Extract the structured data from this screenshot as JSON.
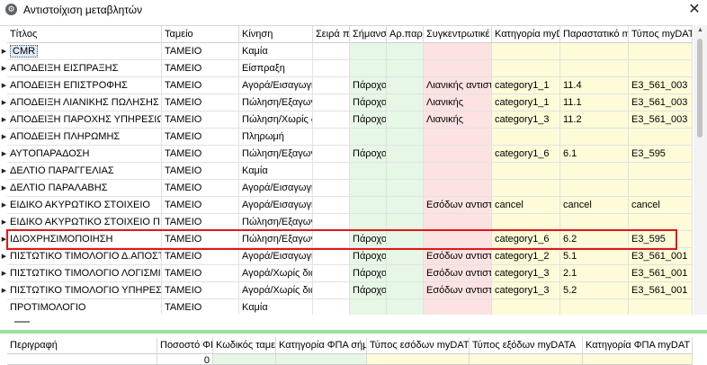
{
  "window": {
    "title": "Αντιστοίχιση μεταβλητών",
    "icon": "gear-icon",
    "close_label": "✕"
  },
  "columns": [
    "Τίτλος",
    "Ταμείο",
    "Κίνηση",
    "Σειρά π",
    "Σήμανσ",
    "Αρ.παρ",
    "Συγκεντρωτικέ",
    "Κατηγορία myDA",
    "Παραστατικό m",
    "Τύπος myDAT"
  ],
  "rows": [
    [
      "CMR",
      "ΤΑΜΕΙΟ",
      "Καμία",
      "",
      "",
      "",
      "",
      "",
      "",
      ""
    ],
    [
      "ΑΠΟΔΕΙΞΗ ΕΙΣΠΡΑΞΗΣ",
      "ΤΑΜΕΙΟ",
      "Είσπραξη",
      "",
      "",
      "",
      "",
      "",
      "",
      ""
    ],
    [
      "ΑΠΟΔΕΙΞΗ ΕΠΙΣΤΡΟΦΗΣ",
      "ΤΑΜΕΙΟ",
      "Αγορά/Εισαγωγή",
      "",
      "Πάροχο",
      "",
      "Λιανικής αντιστ",
      "category1_1",
      "11.4",
      "E3_561_003"
    ],
    [
      "ΑΠΟΔΕΙΞΗ ΛΙΑΝΙΚΗΣ ΠΩΛΗΣΗΣ",
      "ΤΑΜΕΙΟ",
      "Πώληση/Εξαγωγή",
      "",
      "Πάροχο",
      "",
      "Λιανικής",
      "category1_1",
      "11.1",
      "E3_561_003"
    ],
    [
      "ΑΠΟΔΕΙΞΗ ΠΑΡΟΧΗΣ ΥΠΗΡΕΣΙΩΝ",
      "ΤΑΜΕΙΟ",
      "Πώληση/Χωρίς δ",
      "",
      "Πάροχο",
      "",
      "Λιανικής",
      "category1_3",
      "11.2",
      "E3_561_003"
    ],
    [
      "ΑΠΟΔΕΙΞΗ ΠΛΗΡΩΜΗΣ",
      "ΤΑΜΕΙΟ",
      "Πληρωμή",
      "",
      "",
      "",
      "",
      "",
      "",
      ""
    ],
    [
      "ΑΥΤΟΠΑΡΑΔΟΣΗ",
      "ΤΑΜΕΙΟ",
      "Πώληση/Εξαγωγή",
      "",
      "Πάροχο",
      "",
      "",
      "category1_6",
      "6.1",
      "E3_595"
    ],
    [
      "ΔΕΛΤΙΟ ΠΑΡΑΓΓΕΛΙΑΣ",
      "ΤΑΜΕΙΟ",
      "Καμία",
      "",
      "",
      "",
      "",
      "",
      "",
      ""
    ],
    [
      "ΔΕΛΤΙΟ ΠΑΡΑΛΑΒΗΣ",
      "ΤΑΜΕΙΟ",
      "Αγορά/Εισαγωγή",
      "",
      "",
      "",
      "",
      "",
      "",
      ""
    ],
    [
      "ΕΙΔΙΚΟ ΑΚΥΡΩΤΙΚΟ ΣΤΟΙΧΕΙΟ",
      "ΤΑΜΕΙΟ",
      "Αγορά/Εισαγωγή",
      "",
      "",
      "",
      "Εσόδων αντιστ",
      "cancel",
      "cancel",
      "cancel"
    ],
    [
      "ΕΙΔΙΚΟ ΑΚΥΡΩΤΙΚΟ ΣΤΟΙΧΕΙΟ ΠΙΣΤ",
      "ΤΑΜΕΙΟ",
      "Πώληση/Εξαγωγή",
      "",
      "",
      "",
      "",
      "",
      "",
      ""
    ],
    [
      "ΙΔΙΟΧΡΗΣΙΜΟΠΟΙΗΣΗ",
      "ΤΑΜΕΙΟ",
      "Πώληση/Εξαγωγή",
      "",
      "Πάροχο",
      "",
      "",
      "category1_6",
      "6.2",
      "E3_595"
    ],
    [
      "ΠΙΣΤΩΤΙΚΟ ΤΙΜΟΛΟΓΙΟ Δ.ΑΠΟΣΤ",
      "ΤΑΜΕΙΟ",
      "Αγορά/Εισαγωγή",
      "",
      "Πάροχο",
      "",
      "Εσόδων αντιστ",
      "category1_2",
      "5.1",
      "E3_561_001"
    ],
    [
      "ΠΙΣΤΩΤΙΚΟ ΤΙΜΟΛΟΓΙΟ ΛΟΓΙΣΜΙΚ",
      "ΤΑΜΕΙΟ",
      "Αγορά/Χωρίς δια",
      "",
      "Πάροχο",
      "",
      "Εσόδων αντιστ",
      "category1_3",
      "2.1",
      "E3_561_001"
    ],
    [
      "ΠΙΣΤΩΤΙΚΟ ΤΙΜΟΛΟΓΙΟ ΥΠΗΡΕΣΙΩ",
      "ΤΑΜΕΙΟ",
      "Αγορά/Χωρίς δια",
      "",
      "Πάροχο",
      "",
      "Εσόδων αντιστ",
      "category1_3",
      "5.2",
      "E3_561_001"
    ],
    [
      "ΠΡΟΤΙΜΟΛΟΓΙΟ",
      "ΤΑΜΕΙΟ",
      "Καμία",
      "",
      "",
      "",
      "",
      "",
      "",
      ""
    ]
  ],
  "indicators": [
    "▶",
    "▶",
    "▶",
    "▶",
    "▶",
    "▶",
    "▶",
    "▶",
    "▶",
    "▶",
    "▶",
    "▶",
    "▶",
    "▶",
    "▶",
    ""
  ],
  "bottom_columns": [
    "Περιγραφή",
    "Ποσοστό ΦΙ",
    "Κωδικός ταμει",
    "Κατηγορία ΦΠΑ σήμ",
    "Τύπος εσόδων myDAT",
    "Τύπος εξόδων myDATA",
    "Κατηγορία ΦΠΑ myDAT"
  ],
  "bottom_partial_value": "0",
  "colors": {
    "green": "#e6f7e6",
    "pink": "#fde2e2",
    "yellow": "#fdfbd8",
    "highlight": "#e01818",
    "splitter": "#9be09b"
  }
}
